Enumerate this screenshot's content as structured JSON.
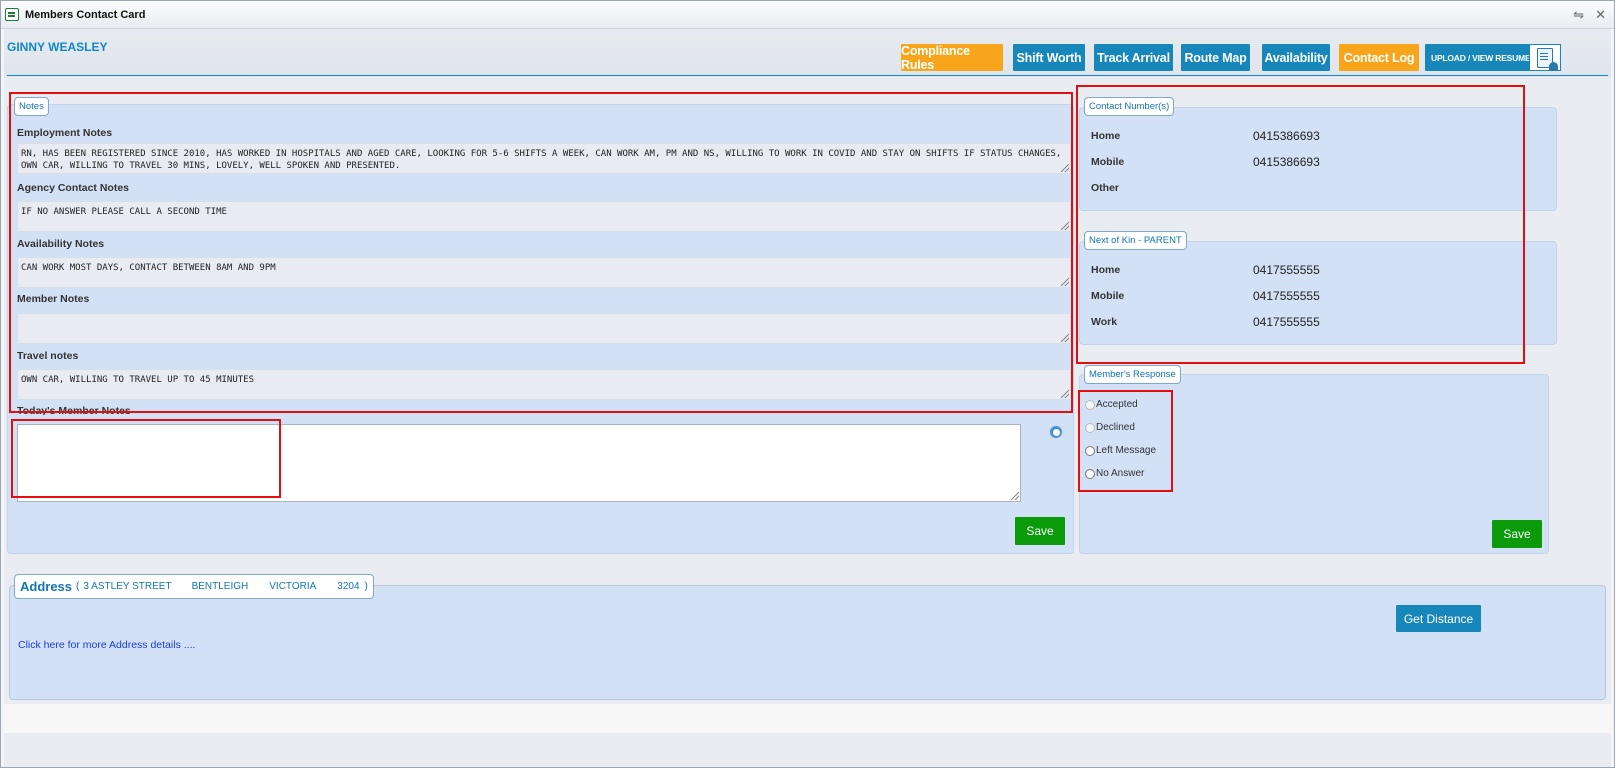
{
  "window": {
    "title": "Members Contact Card",
    "restore_glyph": "⇋",
    "close_glyph": "✕"
  },
  "member": {
    "name": "GINNY WEASLEY"
  },
  "header_buttons": [
    {
      "label": "Compliance Rules",
      "color": "#f8a51c"
    },
    {
      "label": "Shift Worth",
      "color": "#1686bb"
    },
    {
      "label": "Track Arrival",
      "color": "#1686bb"
    },
    {
      "label": "Route Map",
      "color": "#1686bb"
    },
    {
      "label": "Availability",
      "color": "#1686bb"
    },
    {
      "label": "Contact Log",
      "color": "#f8a51c"
    },
    {
      "label": "UPLOAD / VIEW RESUME",
      "color": "#1686bb",
      "icon": "resume-document-icon"
    }
  ],
  "notes": {
    "legend": "Notes",
    "employment": {
      "label": "Employment Notes",
      "value": "RN, HAS BEEN REGISTERED SINCE 2010, HAS WORKED IN HOSPITALS AND AGED CARE, LOOKING FOR 5-6 SHIFTS A WEEK, CAN WORK AM, PM AND NS, WILLING TO WORK IN COVID AND STAY ON SHIFTS IF STATUS CHANGES, OWN CAR, WILLING TO TRAVEL 30 MINS, LOVELY, WELL SPOKEN AND PRESENTED."
    },
    "agency_contact": {
      "label": "Agency Contact Notes",
      "value": "IF NO ANSWER PLEASE CALL A SECOND TIME"
    },
    "availability": {
      "label": "Availability Notes",
      "value": "CAN WORK MOST DAYS, CONTACT BETWEEN 8AM AND 9PM"
    },
    "member": {
      "label": "Member Notes",
      "value": ""
    },
    "travel": {
      "label": "Travel notes",
      "value": "OWN CAR, WILLING TO TRAVEL UP TO 45 MINUTES"
    },
    "today": {
      "label": "Today's Member Notes",
      "value": ""
    },
    "save_label": "Save"
  },
  "contact_numbers": {
    "legend": "Contact Number(s)",
    "rows": [
      {
        "label": "Home",
        "value": "0415386693"
      },
      {
        "label": "Mobile",
        "value": "0415386693"
      },
      {
        "label": "Other",
        "value": ""
      }
    ]
  },
  "next_of_kin": {
    "legend": "Next of Kin - PARENT",
    "rows": [
      {
        "label": "Home",
        "value": "0417555555"
      },
      {
        "label": "Mobile",
        "value": "0417555555"
      },
      {
        "label": "Work",
        "value": "0417555555"
      }
    ]
  },
  "member_response": {
    "legend": "Member's Response",
    "options": [
      "Accepted",
      "Declined",
      "Left Message",
      "No Answer"
    ],
    "save_label": "Save"
  },
  "address": {
    "title": "Address",
    "open_paren": "(",
    "street": "3 ASTLEY STREET",
    "suburb": "BENTLEIGH",
    "state": "VICTORIA",
    "postcode": "3204",
    "close_paren": ")",
    "details_link": "Click here for more Address details ....",
    "get_distance_label": "Get Distance"
  }
}
